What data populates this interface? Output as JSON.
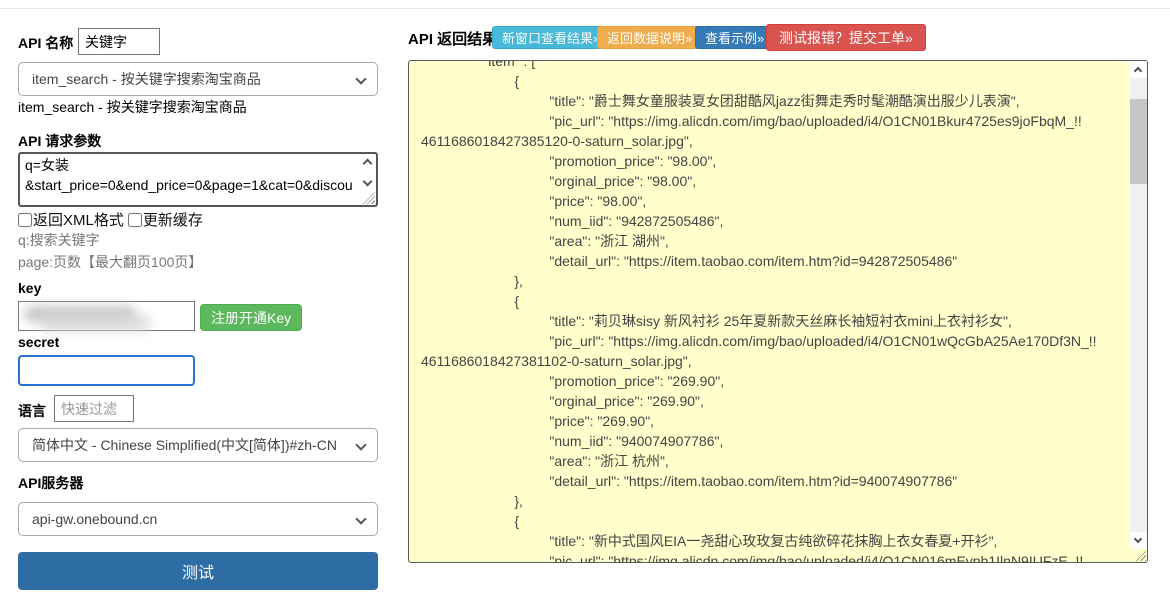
{
  "left": {
    "api_name_label": "API 名称",
    "api_name_value": "关键字",
    "api_select_value": "item_search - 按关键字搜索淘宝商品",
    "api_select_caption": "item_search - 按关键字搜索淘宝商品",
    "params_label": "API 请求参数",
    "params_value": "q=女装\n&start_price=0&end_price=0&page=1&cat=0&discou",
    "xml_checkbox_label": "返回XML格式",
    "cache_checkbox_label": "更新缓存",
    "hint_q": "q:搜索关键字",
    "hint_page": "page:页数【最大翻页100页】",
    "key_label": "key",
    "key_value": "",
    "register_button_label": "注册开通Key",
    "secret_label": "secret",
    "secret_value": "",
    "lang_label": "语言",
    "lang_filter_placeholder": "快速过滤",
    "lang_select_value": "简体中文 - Chinese Simplified(中文[简体])#zh-CN",
    "server_label": "API服务器",
    "server_select_value": "api-gw.onebound.cn",
    "test_button_label": "测试"
  },
  "right": {
    "title": "API 返回结果",
    "buttons": [
      {
        "label": "新窗口查看结果»",
        "color": "#46b8da"
      },
      {
        "label": "返回数据说明»",
        "color": "#f0ad4e"
      },
      {
        "label": "查看示例»",
        "color": "#337ab7"
      },
      {
        "label": "测试报错？提交工单»",
        "color": "#d9534f"
      }
    ],
    "result_bg_color": "#ffffcc",
    "result_text": "                \"item\" : [\n                        {\n                                 \"title\": \"爵士舞女童服装夏女团甜酷风jazz街舞走秀时髦潮酷演出服少儿表演\",\n                                 \"pic_url\": \"https://img.alicdn.com/img/bao/uploaded/i4/O1CN01Bkur4725es9joFbqM_!!\n4611686018427385120-0-saturn_solar.jpg\",\n                                 \"promotion_price\": \"98.00\",\n                                 \"orginal_price\": \"98.00\",\n                                 \"price\": \"98.00\",\n                                 \"num_iid\": \"942872505486\",\n                                 \"area\": \"浙江 湖州\",\n                                 \"detail_url\": \"https://item.taobao.com/item.htm?id=942872505486\"\n                        },\n                        {\n                                 \"title\": \"莉贝琳sisy 新风衬衫 25年夏新款天丝麻长袖短衬衣mini上衣衬衫女\",\n                                 \"pic_url\": \"https://img.alicdn.com/img/bao/uploaded/i4/O1CN01wQcGbA25Ae170Df3N_!!\n4611686018427381102-0-saturn_solar.jpg\",\n                                 \"promotion_price\": \"269.90\",\n                                 \"orginal_price\": \"269.90\",\n                                 \"price\": \"269.90\",\n                                 \"num_iid\": \"940074907786\",\n                                 \"area\": \"浙江 杭州\",\n                                 \"detail_url\": \"https://item.taobao.com/item.htm?id=940074907786\"\n                        },\n                        {\n                                 \"title\": \"新中式国风EIA一尧甜心玫玫复古纯欲碎花抹胸上衣女春夏+开衫\",\n                                 \"pic_url\": \"https://img.alicdn.com/img/bao/uploaded/i4/O1CN016mEvph1IlnN9IUFzE_!!"
  }
}
